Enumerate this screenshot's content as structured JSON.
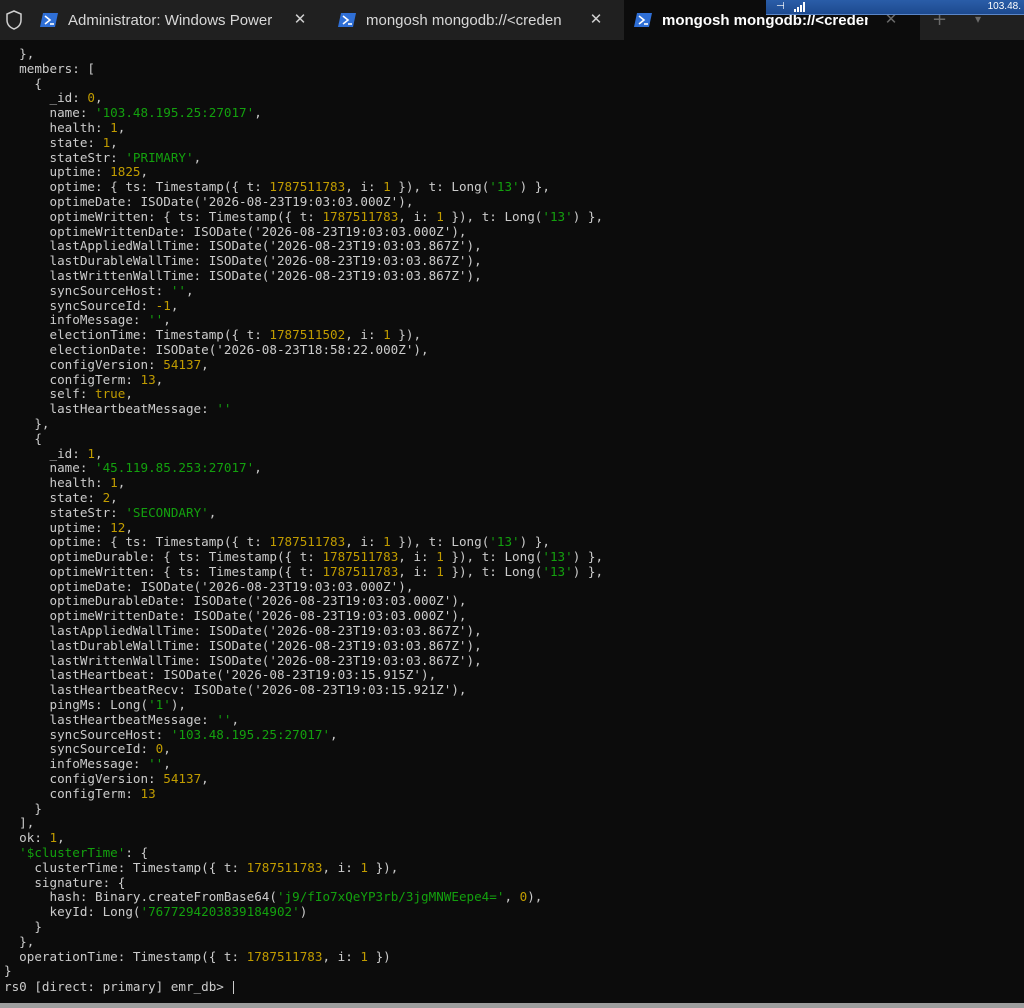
{
  "tabs": [
    {
      "title": "Administrator: Windows Power",
      "active": false
    },
    {
      "title": "mongosh mongodb://<creden",
      "active": false
    },
    {
      "title": "mongosh mongodb://<credentials>",
      "active": true
    }
  ],
  "overlay": {
    "text": "103.48."
  },
  "terminal": {
    "lines": [
      [
        [
          "p",
          "  },"
        ]
      ],
      [
        [
          "p",
          "  members: ["
        ]
      ],
      [
        [
          "p",
          "    {"
        ]
      ],
      [
        [
          "p",
          "      _id: "
        ],
        [
          "n",
          "0"
        ],
        [
          "p",
          ","
        ]
      ],
      [
        [
          "p",
          "      name: "
        ],
        [
          "s",
          "'103.48.195.25:27017'"
        ],
        [
          "p",
          ","
        ]
      ],
      [
        [
          "p",
          "      health: "
        ],
        [
          "n",
          "1"
        ],
        [
          "p",
          ","
        ]
      ],
      [
        [
          "p",
          "      state: "
        ],
        [
          "n",
          "1"
        ],
        [
          "p",
          ","
        ]
      ],
      [
        [
          "p",
          "      stateStr: "
        ],
        [
          "s",
          "'PRIMARY'"
        ],
        [
          "p",
          ","
        ]
      ],
      [
        [
          "p",
          "      uptime: "
        ],
        [
          "n",
          "1825"
        ],
        [
          "p",
          ","
        ]
      ],
      [
        [
          "p",
          "      optime: { ts: Timestamp({ t: "
        ],
        [
          "n",
          "1787511783"
        ],
        [
          "p",
          ", i: "
        ],
        [
          "n",
          "1"
        ],
        [
          "p",
          " }), t: Long("
        ],
        [
          "s",
          "'13'"
        ],
        [
          "p",
          ") },"
        ]
      ],
      [
        [
          "p",
          "      optimeDate: ISODate('2026-08-23T19:03:03.000Z'),"
        ]
      ],
      [
        [
          "p",
          "      optimeWritten: { ts: Timestamp({ t: "
        ],
        [
          "n",
          "1787511783"
        ],
        [
          "p",
          ", i: "
        ],
        [
          "n",
          "1"
        ],
        [
          "p",
          " }), t: Long("
        ],
        [
          "s",
          "'13'"
        ],
        [
          "p",
          ") },"
        ]
      ],
      [
        [
          "p",
          "      optimeWrittenDate: ISODate('2026-08-23T19:03:03.000Z'),"
        ]
      ],
      [
        [
          "p",
          "      lastAppliedWallTime: ISODate('2026-08-23T19:03:03.867Z'),"
        ]
      ],
      [
        [
          "p",
          "      lastDurableWallTime: ISODate('2026-08-23T19:03:03.867Z'),"
        ]
      ],
      [
        [
          "p",
          "      lastWrittenWallTime: ISODate('2026-08-23T19:03:03.867Z'),"
        ]
      ],
      [
        [
          "p",
          "      syncSourceHost: "
        ],
        [
          "s",
          "''"
        ],
        [
          "p",
          ","
        ]
      ],
      [
        [
          "p",
          "      syncSourceId: "
        ],
        [
          "n",
          "-1"
        ],
        [
          "p",
          ","
        ]
      ],
      [
        [
          "p",
          "      infoMessage: "
        ],
        [
          "s",
          "''"
        ],
        [
          "p",
          ","
        ]
      ],
      [
        [
          "p",
          "      electionTime: Timestamp({ t: "
        ],
        [
          "n",
          "1787511502"
        ],
        [
          "p",
          ", i: "
        ],
        [
          "n",
          "1"
        ],
        [
          "p",
          " }),"
        ]
      ],
      [
        [
          "p",
          "      electionDate: ISODate('2026-08-23T18:58:22.000Z'),"
        ]
      ],
      [
        [
          "p",
          "      configVersion: "
        ],
        [
          "n",
          "54137"
        ],
        [
          "p",
          ","
        ]
      ],
      [
        [
          "p",
          "      configTerm: "
        ],
        [
          "n",
          "13"
        ],
        [
          "p",
          ","
        ]
      ],
      [
        [
          "p",
          "      self: "
        ],
        [
          "n",
          "true"
        ],
        [
          "p",
          ","
        ]
      ],
      [
        [
          "p",
          "      lastHeartbeatMessage: "
        ],
        [
          "s",
          "''"
        ]
      ],
      [
        [
          "p",
          "    },"
        ]
      ],
      [
        [
          "p",
          "    {"
        ]
      ],
      [
        [
          "p",
          "      _id: "
        ],
        [
          "n",
          "1"
        ],
        [
          "p",
          ","
        ]
      ],
      [
        [
          "p",
          "      name: "
        ],
        [
          "s",
          "'45.119.85.253:27017'"
        ],
        [
          "p",
          ","
        ]
      ],
      [
        [
          "p",
          "      health: "
        ],
        [
          "n",
          "1"
        ],
        [
          "p",
          ","
        ]
      ],
      [
        [
          "p",
          "      state: "
        ],
        [
          "n",
          "2"
        ],
        [
          "p",
          ","
        ]
      ],
      [
        [
          "p",
          "      stateStr: "
        ],
        [
          "s",
          "'SECONDARY'"
        ],
        [
          "p",
          ","
        ]
      ],
      [
        [
          "p",
          "      uptime: "
        ],
        [
          "n",
          "12"
        ],
        [
          "p",
          ","
        ]
      ],
      [
        [
          "p",
          "      optime: { ts: Timestamp({ t: "
        ],
        [
          "n",
          "1787511783"
        ],
        [
          "p",
          ", i: "
        ],
        [
          "n",
          "1"
        ],
        [
          "p",
          " }), t: Long("
        ],
        [
          "s",
          "'13'"
        ],
        [
          "p",
          ") },"
        ]
      ],
      [
        [
          "p",
          "      optimeDurable: { ts: Timestamp({ t: "
        ],
        [
          "n",
          "1787511783"
        ],
        [
          "p",
          ", i: "
        ],
        [
          "n",
          "1"
        ],
        [
          "p",
          " }), t: Long("
        ],
        [
          "s",
          "'13'"
        ],
        [
          "p",
          ") },"
        ]
      ],
      [
        [
          "p",
          "      optimeWritten: { ts: Timestamp({ t: "
        ],
        [
          "n",
          "1787511783"
        ],
        [
          "p",
          ", i: "
        ],
        [
          "n",
          "1"
        ],
        [
          "p",
          " }), t: Long("
        ],
        [
          "s",
          "'13'"
        ],
        [
          "p",
          ") },"
        ]
      ],
      [
        [
          "p",
          "      optimeDate: ISODate('2026-08-23T19:03:03.000Z'),"
        ]
      ],
      [
        [
          "p",
          "      optimeDurableDate: ISODate('2026-08-23T19:03:03.000Z'),"
        ]
      ],
      [
        [
          "p",
          "      optimeWrittenDate: ISODate('2026-08-23T19:03:03.000Z'),"
        ]
      ],
      [
        [
          "p",
          "      lastAppliedWallTime: ISODate('2026-08-23T19:03:03.867Z'),"
        ]
      ],
      [
        [
          "p",
          "      lastDurableWallTime: ISODate('2026-08-23T19:03:03.867Z'),"
        ]
      ],
      [
        [
          "p",
          "      lastWrittenWallTime: ISODate('2026-08-23T19:03:03.867Z'),"
        ]
      ],
      [
        [
          "p",
          "      lastHeartbeat: ISODate('2026-08-23T19:03:15.915Z'),"
        ]
      ],
      [
        [
          "p",
          "      lastHeartbeatRecv: ISODate('2026-08-23T19:03:15.921Z'),"
        ]
      ],
      [
        [
          "p",
          "      pingMs: Long("
        ],
        [
          "s",
          "'1'"
        ],
        [
          "p",
          "),"
        ]
      ],
      [
        [
          "p",
          "      lastHeartbeatMessage: "
        ],
        [
          "s",
          "''"
        ],
        [
          "p",
          ","
        ]
      ],
      [
        [
          "p",
          "      syncSourceHost: "
        ],
        [
          "s",
          "'103.48.195.25:27017'"
        ],
        [
          "p",
          ","
        ]
      ],
      [
        [
          "p",
          "      syncSourceId: "
        ],
        [
          "n",
          "0"
        ],
        [
          "p",
          ","
        ]
      ],
      [
        [
          "p",
          "      infoMessage: "
        ],
        [
          "s",
          "''"
        ],
        [
          "p",
          ","
        ]
      ],
      [
        [
          "p",
          "      configVersion: "
        ],
        [
          "n",
          "54137"
        ],
        [
          "p",
          ","
        ]
      ],
      [
        [
          "p",
          "      configTerm: "
        ],
        [
          "n",
          "13"
        ]
      ],
      [
        [
          "p",
          "    }"
        ]
      ],
      [
        [
          "p",
          "  ],"
        ]
      ],
      [
        [
          "p",
          "  ok: "
        ],
        [
          "n",
          "1"
        ],
        [
          "p",
          ","
        ]
      ],
      [
        [
          "p",
          "  "
        ],
        [
          "s",
          "'$clusterTime'"
        ],
        [
          "p",
          ": {"
        ]
      ],
      [
        [
          "p",
          "    clusterTime: Timestamp({ t: "
        ],
        [
          "n",
          "1787511783"
        ],
        [
          "p",
          ", i: "
        ],
        [
          "n",
          "1"
        ],
        [
          "p",
          " }),"
        ]
      ],
      [
        [
          "p",
          "    signature: {"
        ]
      ],
      [
        [
          "p",
          "      hash: Binary.createFromBase64("
        ],
        [
          "s",
          "'j9/fIo7xQeYP3rb/3jgMNWEepe4='"
        ],
        [
          "p",
          ", "
        ],
        [
          "n",
          "0"
        ],
        [
          "p",
          "),"
        ]
      ],
      [
        [
          "p",
          "      keyId: Long("
        ],
        [
          "s",
          "'7677294203839184902'"
        ],
        [
          "p",
          ")"
        ]
      ],
      [
        [
          "p",
          "    }"
        ]
      ],
      [
        [
          "p",
          "  },"
        ]
      ],
      [
        [
          "p",
          "  operationTime: Timestamp({ t: "
        ],
        [
          "n",
          "1787511783"
        ],
        [
          "p",
          ", i: "
        ],
        [
          "n",
          "1"
        ],
        [
          "p",
          " })"
        ]
      ],
      [
        [
          "p",
          "}"
        ]
      ]
    ],
    "prompt": "rs0 [direct: primary] emr_db> "
  },
  "colors": {
    "number": "#c19c00",
    "string": "#13a10e",
    "text": "#cccccc",
    "background": "#0c0c0c"
  }
}
